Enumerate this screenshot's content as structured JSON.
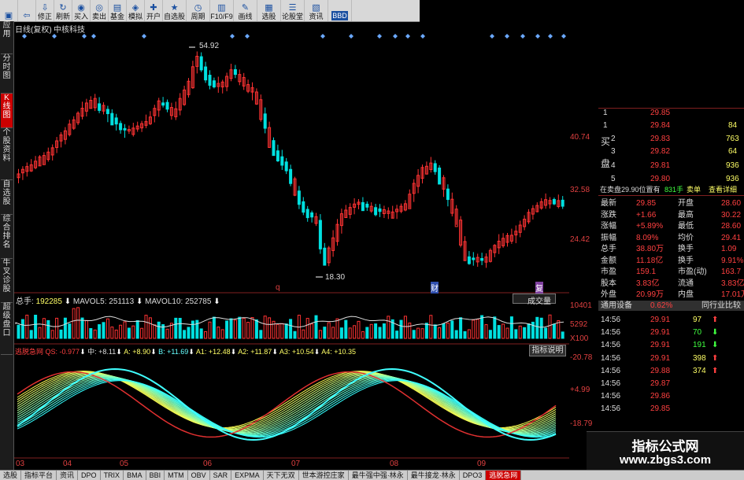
{
  "toolbar": {
    "buttons": [
      "",
      "",
      "修正",
      "刷新",
      "买入",
      "卖出",
      "基金",
      "模拟",
      "开户",
      "自选股",
      "周期",
      "F10/F9",
      "画线",
      "选股",
      "论股堂",
      "资讯",
      "BBD"
    ]
  },
  "sidebar": {
    "items": [
      "应用",
      "分时图",
      "K线图",
      "个股资料",
      "自选股",
      "综合排名",
      "牛叉诊股",
      "超级盘口"
    ]
  },
  "kline": {
    "title": "日线(复权)",
    "stock_name": "中核科技",
    "price_labels": [
      "40.74",
      "32.58",
      "24.42"
    ],
    "high_label": "54.92",
    "low_label": "18.30",
    "marker_q": "q",
    "marker_cai": "财",
    "marker_fu": "复",
    "diamond_x": [
      13,
      51,
      89,
      101,
      165,
      277,
      296,
      392,
      428,
      464,
      484,
      500,
      519,
      607,
      626,
      646,
      665,
      681,
      698
    ]
  },
  "volume": {
    "label_total": "总手",
    "total": "192285",
    "mavol5_label": "MAVOL5",
    "mavol5": "251113",
    "mavol10_label": "MAVOL10",
    "mavol10": "252785",
    "axis": [
      "10401",
      "5292",
      "X100"
    ],
    "select_label": "成交量"
  },
  "indicator": {
    "name": "逃脱急网",
    "items": [
      "QS: -0.977",
      "中: +8.11",
      "A: +8.90",
      "B: +11.69",
      "A1: +12.48",
      "A2: +11.87",
      "A3: +10.54",
      "A4: +10.35"
    ],
    "axis": [
      "-20.78",
      "+4.99",
      "-18.79"
    ],
    "explain_button": "指标说明"
  },
  "xaxis": [
    "03",
    "04",
    "05",
    "06",
    "07",
    "08",
    "09"
  ],
  "quote": {
    "side_buy": "买",
    "side_sell": "盘",
    "book": [
      {
        "level": "1",
        "price": "29.85",
        "vol": ""
      },
      {
        "level": "1",
        "price": "29.84",
        "vol": "84"
      },
      {
        "level": "2",
        "price": "29.83",
        "vol": "763"
      },
      {
        "level": "3",
        "price": "29.82",
        "vol": "64"
      },
      {
        "level": "4",
        "price": "29.81",
        "vol": "936"
      },
      {
        "level": "5",
        "price": "29.80",
        "vol": "936"
      }
    ],
    "notice": "在卖盘29.90位置有",
    "notice_vol": "831手",
    "notice_tag": "卖单",
    "notice_link": "查看详细",
    "stats": [
      {
        "l1": "最新",
        "v1": "29.85",
        "l2": "开盘",
        "v2": "28.60"
      },
      {
        "l1": "涨跌",
        "v1": "+1.66",
        "l2": "最高",
        "v2": "30.22"
      },
      {
        "l1": "涨幅",
        "v1": "+5.89%",
        "l2": "最低",
        "v2": "28.60"
      },
      {
        "l1": "振幅",
        "v1": "8.09%",
        "l2": "均价",
        "v2": "29.41"
      },
      {
        "l1": "总手",
        "v1": "38.80万",
        "l2": "换手",
        "v2": "1.09"
      },
      {
        "l1": "金额",
        "v1": "11.18亿",
        "l2": "换手",
        "v2": "9.91%"
      },
      {
        "l1": "市盈",
        "v1": "159.1",
        "l2": "市盈(动)",
        "v2": "163.7"
      },
      {
        "l1": "股本",
        "v1": "3.83亿",
        "l2": "流通",
        "v2": "3.83亿"
      },
      {
        "l1": "外盘",
        "v1": "20.99万",
        "l2": "内盘",
        "v2": "17.01万"
      }
    ],
    "section_label": "通用设备",
    "section_pct": "0.62%",
    "section_link": "同行业比较",
    "ticks": [
      {
        "time": "14:56",
        "price": "29.91",
        "vol": "97",
        "dir": "up"
      },
      {
        "time": "14:56",
        "price": "29.91",
        "vol": "70",
        "dir": "down"
      },
      {
        "time": "14:56",
        "price": "29.91",
        "vol": "191",
        "dir": "down"
      },
      {
        "time": "14:56",
        "price": "29.91",
        "vol": "398",
        "dir": "up"
      },
      {
        "time": "14:56",
        "price": "29.88",
        "vol": "374",
        "dir": "up"
      },
      {
        "time": "14:56",
        "price": "29.87",
        "vol": "",
        "dir": ""
      },
      {
        "time": "14:56",
        "price": "29.86",
        "vol": "",
        "dir": ""
      },
      {
        "time": "14:56",
        "price": "29.85",
        "vol": "",
        "dir": ""
      }
    ]
  },
  "watermark": {
    "title": "指标公式网",
    "url": "www.zbgs3.com"
  },
  "tabs": [
    "选股",
    "指标平台",
    "资讯",
    "DPO",
    "TRIX",
    "BMA",
    "BBI",
    "MTM",
    "OBV",
    "SAR",
    "EXPMA",
    "天下无双",
    "世本游控庄家",
    "最牛强中强·林永",
    "最牛接龙·林永",
    "DPO3",
    "逃脱急网"
  ],
  "colors": {
    "up": "#ff3333",
    "down": "#00e0e0",
    "yellow": "#ffff33",
    "cyan": "#33ffff"
  }
}
